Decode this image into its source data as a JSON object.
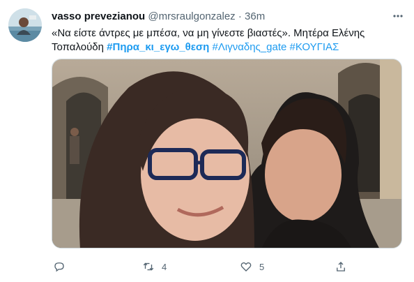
{
  "tweet": {
    "display_name": "vasso prevezianou",
    "handle": "@mrsraulgonzalez",
    "separator": "·",
    "time": "36m",
    "text_line1": "«Να είστε άντρες με μπέσα, να μη γίνεστε βιαστές». Μητέρα Ελένης",
    "text_line2_prefix": "Τοπαλούδη",
    "hashtag_1": "#Πηρα_κι_εγω_θεση",
    "hashtag_2": "#Λιγναδης_gate",
    "hashtag_3": "#ΚΟΥΓΙΑΣ"
  },
  "actions": {
    "reply_icon": "reply-icon",
    "retweet_icon": "retweet-icon",
    "retweet_count": "4",
    "like_icon": "heart-icon",
    "like_count": "5",
    "share_icon": "share-icon"
  },
  "colors": {
    "link": "#1d9bf0",
    "secondary_text": "#536471",
    "border": "#cfd9de"
  }
}
